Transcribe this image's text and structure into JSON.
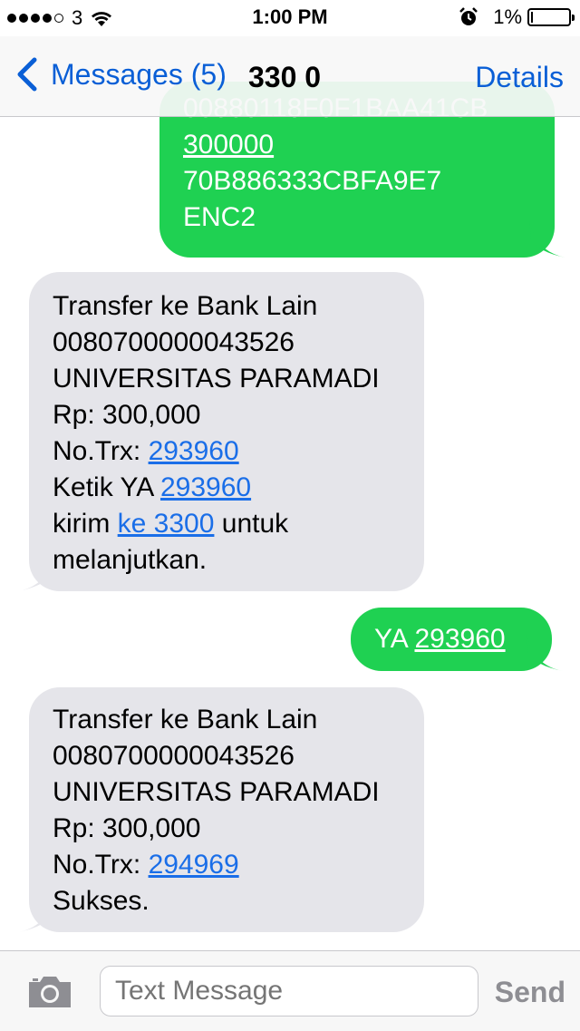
{
  "status_bar": {
    "carrier": "3",
    "time": "1:00 PM",
    "battery_percent": "1%",
    "battery_level": 0.01
  },
  "nav": {
    "back_label": "Messages (5)",
    "title": "330 0",
    "details_label": "Details"
  },
  "messages": [
    {
      "direction": "outgoing",
      "lines": [
        [
          {
            "text": "00880118F0F1BAA41CB"
          }
        ],
        [
          {
            "text": "300000",
            "link": true
          }
        ],
        [
          {
            "text": "70B886333CBFA9E7"
          }
        ],
        [
          {
            "text": "ENC2"
          }
        ]
      ]
    },
    {
      "direction": "incoming",
      "lines": [
        [
          {
            "text": "Transfer ke Bank Lain"
          }
        ],
        [
          {
            "text": "0080700000043526"
          }
        ],
        [
          {
            "text": "UNIVERSITAS PARAMADI"
          }
        ],
        [
          {
            "text": "Rp: 300,000"
          }
        ],
        [
          {
            "text": "No.Trx: "
          },
          {
            "text": "293960",
            "link": true
          }
        ],
        [
          {
            "text": "Ketik YA "
          },
          {
            "text": "293960",
            "link": true
          }
        ],
        [
          {
            "text": "kirim "
          },
          {
            "text": "ke 3300",
            "link": true
          },
          {
            "text": " untuk"
          }
        ],
        [
          {
            "text": "melanjutkan."
          }
        ]
      ]
    },
    {
      "direction": "outgoing",
      "lines": [
        [
          {
            "text": "YA "
          },
          {
            "text": "293960",
            "link": true
          }
        ]
      ]
    },
    {
      "direction": "incoming",
      "lines": [
        [
          {
            "text": "Transfer ke Bank Lain"
          }
        ],
        [
          {
            "text": "0080700000043526"
          }
        ],
        [
          {
            "text": "UNIVERSITAS PARAMADI"
          }
        ],
        [
          {
            "text": "Rp: 300,000"
          }
        ],
        [
          {
            "text": "No.Trx: "
          },
          {
            "text": "294969",
            "link": true
          }
        ],
        [
          {
            "text": "Sukses."
          }
        ]
      ]
    }
  ],
  "input_bar": {
    "placeholder": "Text Message",
    "send_label": "Send"
  },
  "icons": {
    "back": "chevron-left-icon",
    "camera": "camera-icon",
    "wifi": "wifi-icon",
    "alarm": "alarm-clock-icon",
    "battery": "battery-icon"
  },
  "colors": {
    "accent": "#0a5fd6",
    "outgoing_bubble": "#1fd152",
    "incoming_bubble": "#e5e5ea",
    "link_incoming": "#1a6ee8"
  }
}
